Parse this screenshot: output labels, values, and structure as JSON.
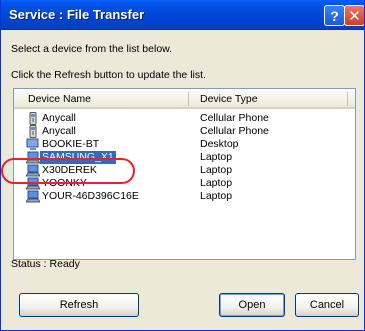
{
  "window": {
    "title": "Service : File Transfer"
  },
  "instructions": {
    "line1": "Select a device from the list below.",
    "line2": "Click the Refresh button to update the list."
  },
  "list": {
    "columns": [
      "Device Name",
      "Device Type"
    ],
    "rows": [
      {
        "name": "Anycall",
        "type": "Cellular Phone",
        "icon": "phone-icon"
      },
      {
        "name": "Anycall",
        "type": "Cellular Phone",
        "icon": "phone-icon"
      },
      {
        "name": "BOOKIE-BT",
        "type": "Desktop",
        "icon": "desktop-icon"
      },
      {
        "name": "SAMSUNG_X1",
        "type": "Laptop",
        "icon": "laptop-icon",
        "selected": true
      },
      {
        "name": "X30DEREK",
        "type": "Laptop",
        "icon": "laptop-icon"
      },
      {
        "name": "YOONKY",
        "type": "Laptop",
        "icon": "laptop-icon"
      },
      {
        "name": "YOUR-46D396C16E",
        "type": "Laptop",
        "icon": "laptop-icon"
      }
    ]
  },
  "status": {
    "text": "Status : Ready"
  },
  "buttons": {
    "refresh": "Refresh",
    "open": "Open",
    "cancel": "Cancel",
    "help": "?",
    "close": "✕"
  },
  "colors": {
    "title_bar": "#0048d8",
    "selection": "#316ac5",
    "annotation_ring": "#e8212b",
    "dialog_bg": "#ece9d8"
  }
}
